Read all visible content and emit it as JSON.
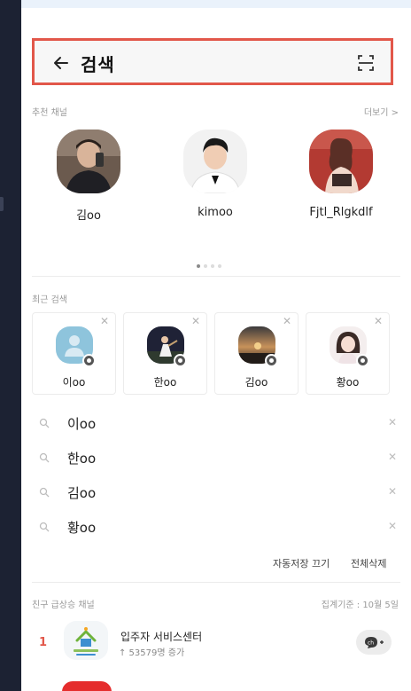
{
  "header": {
    "title": "검색"
  },
  "recommended": {
    "label": "추천 채널",
    "more": "더보기 >",
    "items": [
      {
        "name": "김oo"
      },
      {
        "name": "kimoo"
      },
      {
        "name": "Fjtl_Rlgkdlf"
      }
    ],
    "pager": {
      "pages": 4,
      "active": 1
    }
  },
  "recent": {
    "label": "최근 검색",
    "cards": [
      {
        "name": "이oo"
      },
      {
        "name": "한oo"
      },
      {
        "name": "김oo"
      },
      {
        "name": "황oo"
      }
    ],
    "history": [
      {
        "text": "이oo"
      },
      {
        "text": "한oo"
      },
      {
        "text": "김oo"
      },
      {
        "text": "황oo"
      }
    ],
    "autosave_off": "자동저장 끄기",
    "delete_all": "전체삭제"
  },
  "rising": {
    "label": "친구 급상승 채널",
    "date": "집계기준 : 10월 5일",
    "items": [
      {
        "rank": "1",
        "name": "입주자 서비스센터",
        "delta": "↑ 53579명 증가"
      }
    ]
  },
  "colors": {
    "highlight": "#e2574a",
    "text": "#222222",
    "muted": "#9a9a9a"
  }
}
